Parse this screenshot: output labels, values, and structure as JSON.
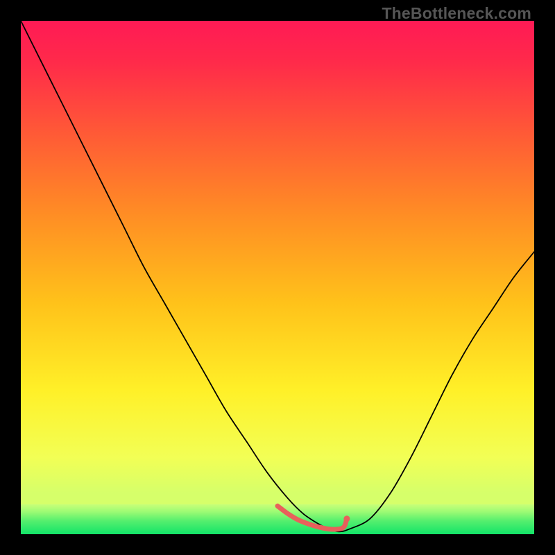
{
  "watermark": "TheBottleneck.com",
  "chart_data": {
    "type": "line",
    "title": "",
    "xlabel": "",
    "ylabel": "",
    "xlim": [
      0,
      100
    ],
    "ylim": [
      0,
      100
    ],
    "grid": false,
    "legend": false,
    "background_gradient": {
      "top_color": "#ff1a4d",
      "mid_colors": [
        "#ff7a2a",
        "#ffd21f",
        "#f4ff3a"
      ],
      "bottom_color": "#17e86a"
    },
    "series": [
      {
        "name": "bottleneck-curve",
        "stroke": "#000000",
        "stroke_width": 1.6,
        "x": [
          0,
          4,
          8,
          12,
          16,
          20,
          24,
          28,
          32,
          36,
          40,
          44,
          48,
          52,
          55,
          58,
          60,
          62,
          64,
          68,
          72,
          76,
          80,
          84,
          88,
          92,
          96,
          100
        ],
        "y": [
          100,
          92,
          84,
          76,
          68,
          60,
          52,
          45,
          38,
          31,
          24,
          18,
          12,
          7,
          4,
          2,
          1,
          0.5,
          1,
          3,
          8,
          15,
          23,
          31,
          38,
          44,
          50,
          55
        ]
      },
      {
        "name": "optimal-band-marker",
        "stroke": "#e8605b",
        "stroke_width": 6,
        "x": [
          50,
          52,
          54,
          56,
          58,
          60,
          62,
          63,
          63.5
        ],
        "y": [
          5.5,
          4,
          2.8,
          2,
          1.4,
          1,
          1,
          1.5,
          3
        ]
      }
    ],
    "green_band": {
      "y_start": 0,
      "y_end": 6,
      "note": "gradient fades from pale green-yellow to solid green at the very bottom"
    }
  }
}
